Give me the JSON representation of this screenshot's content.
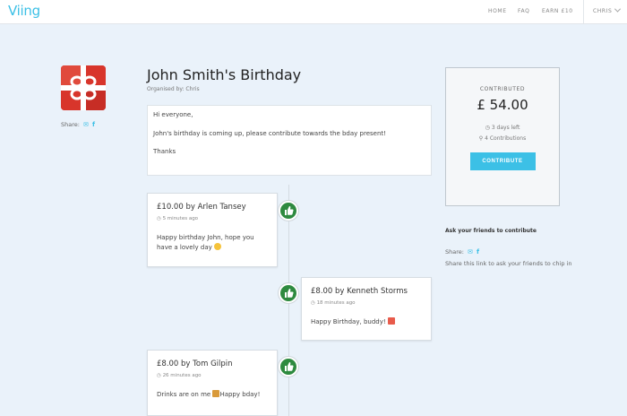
{
  "brand": {
    "logo_text": "Viing",
    "accent": "#3cc0e6"
  },
  "nav": {
    "links": [
      "HOME",
      "FAQ",
      "EARN £10"
    ],
    "user": "CHRIS"
  },
  "event": {
    "title": "John Smith's Birthday",
    "organiser": "Organised by: Chris",
    "share_label": "Share:",
    "message": [
      "Hi everyone,",
      "John's birthday is coming up, please contribute towards the bday present!",
      "Thanks"
    ]
  },
  "contributions": [
    {
      "title": "£10.00 by Arlen Tansey",
      "time": "5 minutes ago",
      "message": "Happy birthday John, hope you have a lovely day"
    },
    {
      "title": "£8.00 by Kenneth Storms",
      "time": "18 minutes ago",
      "message": "Happy Birthday, buddy!"
    },
    {
      "title": "£8.00 by Tom Gilpin",
      "time": "26 minutes ago",
      "message": "Drinks are on me",
      "message_tail": "Happy bday!"
    }
  ],
  "panel": {
    "label": "CONTRIBUTED",
    "amount": "£ 54.00",
    "days_left": "3 days left",
    "count": "4 Contributions",
    "button": "CONTRIBUTE"
  },
  "sharing": {
    "heading": "Ask your friends to contribute",
    "share_label": "Share:",
    "hint": "Share this link to ask your friends to chip in"
  },
  "icons": {
    "badge": "thumbs-up-icon",
    "email": "email-icon",
    "facebook": "facebook-icon",
    "clock": "clock-icon",
    "user": "user-icon",
    "gift": "gift-icon"
  },
  "colors": {
    "badge": "#2e8a3f",
    "gift": "#d8352b"
  }
}
